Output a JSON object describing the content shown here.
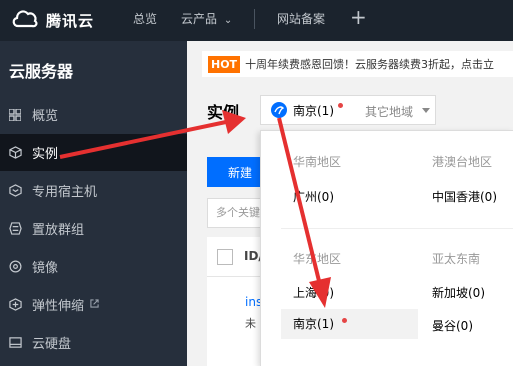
{
  "topbar": {
    "brand": "腾讯云",
    "nav": [
      "总览",
      "云产品",
      "网站备案"
    ],
    "product_caret": "⌄",
    "plus": "+"
  },
  "sidebar": {
    "title": "云服务器",
    "items": [
      {
        "label": "概览",
        "icon": "grid-icon"
      },
      {
        "label": "实例",
        "icon": "cube-icon",
        "active": true
      },
      {
        "label": "专用宿主机",
        "icon": "host-icon"
      },
      {
        "label": "置放群组",
        "icon": "group-icon"
      },
      {
        "label": "镜像",
        "icon": "disc-icon"
      },
      {
        "label": "弹性伸缩",
        "icon": "scale-icon",
        "external": true
      },
      {
        "label": "云硬盘",
        "icon": "disk-icon"
      }
    ]
  },
  "main": {
    "banner_hot": "HOT",
    "banner_text": "十周年续费感恩回馈！云服务器续费3折起，点击立",
    "page_title": "实例",
    "selected_region": "南京(1)",
    "other_region": "其它地域",
    "new_button": "新建",
    "search_placeholder": "多个关键",
    "table_col_id": "ID/",
    "row_link": "ins",
    "row_sub": "未"
  },
  "dropdown": {
    "groups": [
      {
        "title": "华南地区",
        "regions": [
          "广州(0)"
        ]
      },
      {
        "title": "港澳台地区",
        "regions": [
          "中国香港(0)"
        ]
      },
      {
        "title": "华东地区",
        "regions": [
          "上海(0)",
          "南京(1)"
        ]
      },
      {
        "title": "亚太东南",
        "regions": [
          "新加坡(0)",
          "曼谷(0)"
        ]
      }
    ]
  },
  "colors": {
    "accent": "#006eff",
    "annotation_arrow": "#e53030",
    "hot": "#ff7200",
    "topbar": "#1b232d",
    "sidebar": "#262f3c"
  }
}
